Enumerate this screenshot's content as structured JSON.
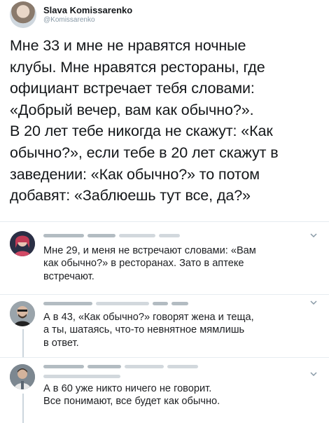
{
  "tweet": {
    "author": {
      "name": "Slava Komissarenko",
      "handle": "@Komissarenko"
    },
    "lines": [
      "Мне 33 и мне не нравятся ночные",
      "клубы. Мне нравятся рестораны, где",
      "официант встречает тебя словами:",
      "«Добрый вечер, вам как обычно?».",
      "В 20 лет тебе никогда не скажут: «Как",
      "обычно?», если тебе в 20 лет скажут в",
      "заведении: «Как обычно?» то потом",
      "добавят: «Заблюешь тут все, да?»"
    ]
  },
  "replies": [
    {
      "lines": [
        "Мне 29, и меня не встречают словами: «Вам",
        "как обычно?» в ресторанах. Зато в аптеке",
        "встречают."
      ]
    },
    {
      "lines": [
        "А в 43, «Как обычно?» говорят жена и теща,",
        "а ты, шатаясь, что-то невнятное мямлишь",
        "в ответ."
      ]
    },
    {
      "lines": [
        "А в 60 уже никто ничего не говорит.",
        "Все понимают, все будет как обычно."
      ]
    }
  ],
  "icons": {
    "reply_menu": "chevron-down-icon"
  },
  "colors": {
    "text": "#14171a",
    "secondary": "#8899a6",
    "divider": "#e6ecf0"
  }
}
